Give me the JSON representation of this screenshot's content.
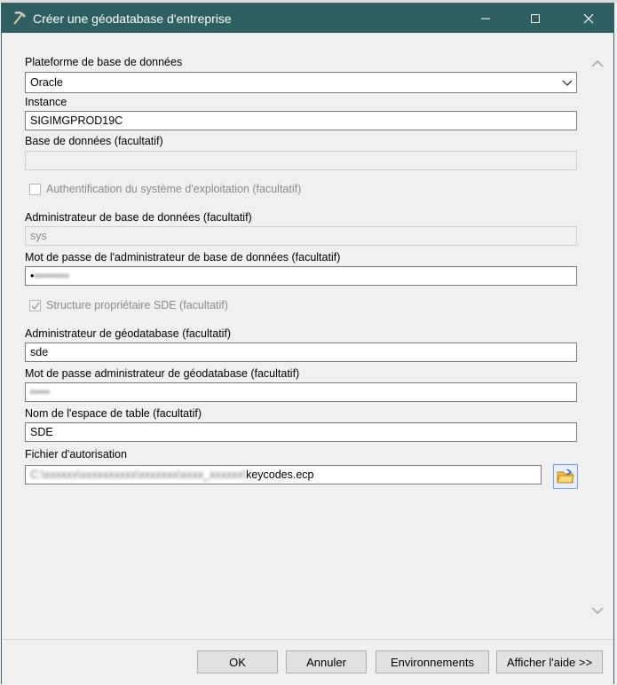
{
  "window": {
    "title": "Créer une géodatabase d'entreprise"
  },
  "form": {
    "platform": {
      "label": "Plateforme de base de données",
      "value": "Oracle"
    },
    "instance": {
      "label": "Instance",
      "value": "SIGIMGPROD19C"
    },
    "database": {
      "label": "Base de données (facultatif)",
      "value": ""
    },
    "os_auth": {
      "label": "Authentification du système d'exploitation (facultatif)",
      "checked": false
    },
    "db_admin": {
      "label": "Administrateur de base de données (facultatif)",
      "value": "sys"
    },
    "db_admin_password": {
      "label": "Mot de passe de l'administrateur de base de données (facultatif)",
      "value": "•"
    },
    "sde_schema": {
      "label": "Structure propriétaire SDE (facultatif)",
      "checked": true
    },
    "gdb_admin": {
      "label": "Administrateur de géodatabase (facultatif)",
      "value": "sde"
    },
    "gdb_admin_password": {
      "label": "Mot de passe administrateur de géodatabase (facultatif)",
      "value": ""
    },
    "tablespace": {
      "label": "Nom de l'espace de table (facultatif)",
      "value": "SDE"
    },
    "auth_file": {
      "label": "Fichier d'autorisation",
      "value": "keycodes.ecp"
    }
  },
  "buttons": {
    "ok": "OK",
    "cancel": "Annuler",
    "environments": "Environnements",
    "help": "Afficher l'aide >>"
  },
  "colors": {
    "titlebar": "#2e5f63",
    "accent": "#2e5f63"
  }
}
